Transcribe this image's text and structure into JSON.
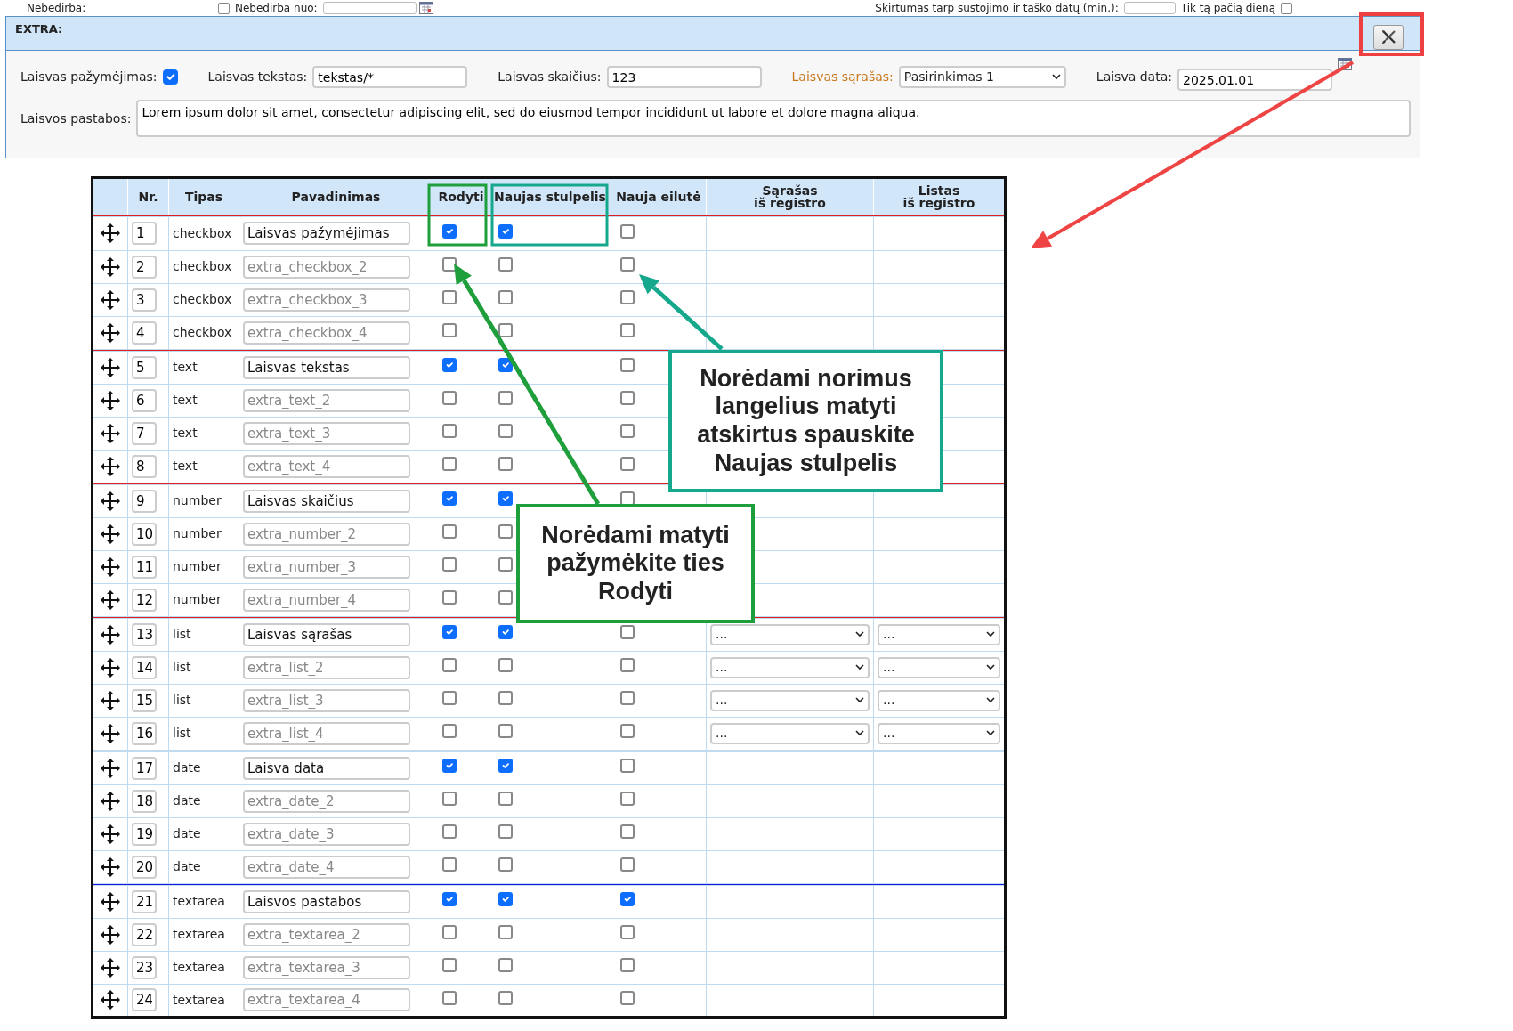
{
  "top_strip": {
    "left_label": "Nebedirba:",
    "mid_checkbox": {
      "label": "Nebedirba nuo:",
      "checked": false
    },
    "right_label": "Skirtumas tarp sustojimo ir taško datų (min.):",
    "right_checkbox": {
      "label": "Tik tą pačią dieną",
      "checked": false
    }
  },
  "extra": {
    "title": "EXTRA:",
    "fields": [
      {
        "kind": "checkbox",
        "label": "Laisvas pažymėjimas:",
        "checked": true,
        "color": "#222222"
      },
      {
        "kind": "text",
        "label": "Laisvas tekstas:",
        "value": "tekstas/*",
        "color": "#222222"
      },
      {
        "kind": "text",
        "label": "Laisvas skaičius:",
        "value": "123",
        "color": "#222222"
      },
      {
        "kind": "select",
        "label": "Laisvas sąrašas:",
        "value": "Pasirinkimas 1",
        "color": "#c8781e"
      },
      {
        "kind": "date",
        "label": "Laisva data:",
        "value": "2025.01.01",
        "color": "#222222"
      }
    ],
    "notes": {
      "label": "Laisvos pastabos:",
      "value": "Lorem ipsum dolor sit amet, consectetur adipiscing elit, sed do eiusmod tempor incididunt ut labore et dolore magna aliqua."
    }
  },
  "table": {
    "columns": [
      "Nr.",
      "Tipas",
      "Pavadinimas",
      "Rodyti",
      "Naujas stulpelis",
      "Nauja eilutė",
      "Sąrašas\niš registro",
      "Listas\niš registro"
    ],
    "groups": [
      {
        "color": "#e02020",
        "rows": [
          {
            "nr": "1",
            "type": "checkbox",
            "name": {
              "value": "Laisvas pažymėjimas"
            },
            "show": true,
            "new_column": true,
            "new_row": false
          },
          {
            "nr": "2",
            "type": "checkbox",
            "name": {
              "placeholder": "extra_checkbox_2"
            },
            "show": false,
            "new_column": false,
            "new_row": false
          },
          {
            "nr": "3",
            "type": "checkbox",
            "name": {
              "placeholder": "extra_checkbox_3"
            },
            "show": false,
            "new_column": false,
            "new_row": false
          },
          {
            "nr": "4",
            "type": "checkbox",
            "name": {
              "placeholder": "extra_checkbox_4"
            },
            "show": false,
            "new_column": false,
            "new_row": false
          }
        ]
      },
      {
        "color": "#e02020",
        "rows": [
          {
            "nr": "5",
            "type": "text",
            "name": {
              "value": "Laisvas tekstas"
            },
            "show": true,
            "new_column": true,
            "new_row": false
          },
          {
            "nr": "6",
            "type": "text",
            "name": {
              "placeholder": "extra_text_2"
            },
            "show": false,
            "new_column": false,
            "new_row": false
          },
          {
            "nr": "7",
            "type": "text",
            "name": {
              "placeholder": "extra_text_3"
            },
            "show": false,
            "new_column": false,
            "new_row": false
          },
          {
            "nr": "8",
            "type": "text",
            "name": {
              "placeholder": "extra_text_4"
            },
            "show": false,
            "new_column": false,
            "new_row": false
          }
        ]
      },
      {
        "color": "#e02020",
        "rows": [
          {
            "nr": "9",
            "type": "number",
            "name": {
              "value": "Laisvas skaičius"
            },
            "show": true,
            "new_column": true,
            "new_row": false
          },
          {
            "nr": "10",
            "type": "number",
            "name": {
              "placeholder": "extra_number_2"
            },
            "show": false,
            "new_column": false
          },
          {
            "nr": "11",
            "type": "number",
            "name": {
              "placeholder": "extra_number_3"
            },
            "show": false,
            "new_column": false
          },
          {
            "nr": "12",
            "type": "number",
            "name": {
              "placeholder": "extra_number_4"
            },
            "show": false,
            "new_column": false
          }
        ]
      },
      {
        "color": "#e02020",
        "rows": [
          {
            "nr": "13",
            "type": "list",
            "name": {
              "value": "Laisvas sąrašas"
            },
            "show": true,
            "new_column": true,
            "new_row": false,
            "registry_list": "...",
            "registry_listas": "..."
          },
          {
            "nr": "14",
            "type": "list",
            "name": {
              "placeholder": "extra_list_2"
            },
            "show": false,
            "new_column": false,
            "new_row": false,
            "registry_list": "...",
            "registry_listas": "..."
          },
          {
            "nr": "15",
            "type": "list",
            "name": {
              "placeholder": "extra_list_3"
            },
            "show": false,
            "new_column": false,
            "new_row": false,
            "registry_list": "...",
            "registry_listas": "..."
          },
          {
            "nr": "16",
            "type": "list",
            "name": {
              "placeholder": "extra_list_4"
            },
            "show": false,
            "new_column": false,
            "new_row": false,
            "registry_list": "...",
            "registry_listas": "..."
          }
        ]
      },
      {
        "color": "#e02020",
        "rows": [
          {
            "nr": "17",
            "type": "date",
            "name": {
              "value": "Laisva data"
            },
            "show": true,
            "new_column": true,
            "new_row": false
          },
          {
            "nr": "18",
            "type": "date",
            "name": {
              "placeholder": "extra_date_2"
            },
            "show": false,
            "new_column": false,
            "new_row": false
          },
          {
            "nr": "19",
            "type": "date",
            "name": {
              "placeholder": "extra_date_3"
            },
            "show": false,
            "new_column": false,
            "new_row": false
          },
          {
            "nr": "20",
            "type": "date",
            "name": {
              "placeholder": "extra_date_4"
            },
            "show": false,
            "new_column": false,
            "new_row": false
          }
        ]
      },
      {
        "color": "#1a1ae0",
        "rows": [
          {
            "nr": "21",
            "type": "textarea",
            "name": {
              "value": "Laisvos pastabos"
            },
            "show": true,
            "new_column": true,
            "new_row": true
          },
          {
            "nr": "22",
            "type": "textarea",
            "name": {
              "placeholder": "extra_textarea_2"
            },
            "show": false,
            "new_column": false,
            "new_row": false
          },
          {
            "nr": "23",
            "type": "textarea",
            "name": {
              "placeholder": "extra_textarea_3"
            },
            "show": false,
            "new_column": false,
            "new_row": false
          },
          {
            "nr": "24",
            "type": "textarea",
            "name": {
              "placeholder": "extra_textarea_4"
            },
            "show": false,
            "new_column": false,
            "new_row": false
          }
        ]
      }
    ]
  },
  "callouts": [
    {
      "text": "Norėdami norimus langelius matyti atskirtus spauskite Naujas stulpelis",
      "color": "#16a88c"
    },
    {
      "text": "Norėdami matyti pažymėkite ties Rodyti",
      "color": "#1f9e3c"
    }
  ]
}
